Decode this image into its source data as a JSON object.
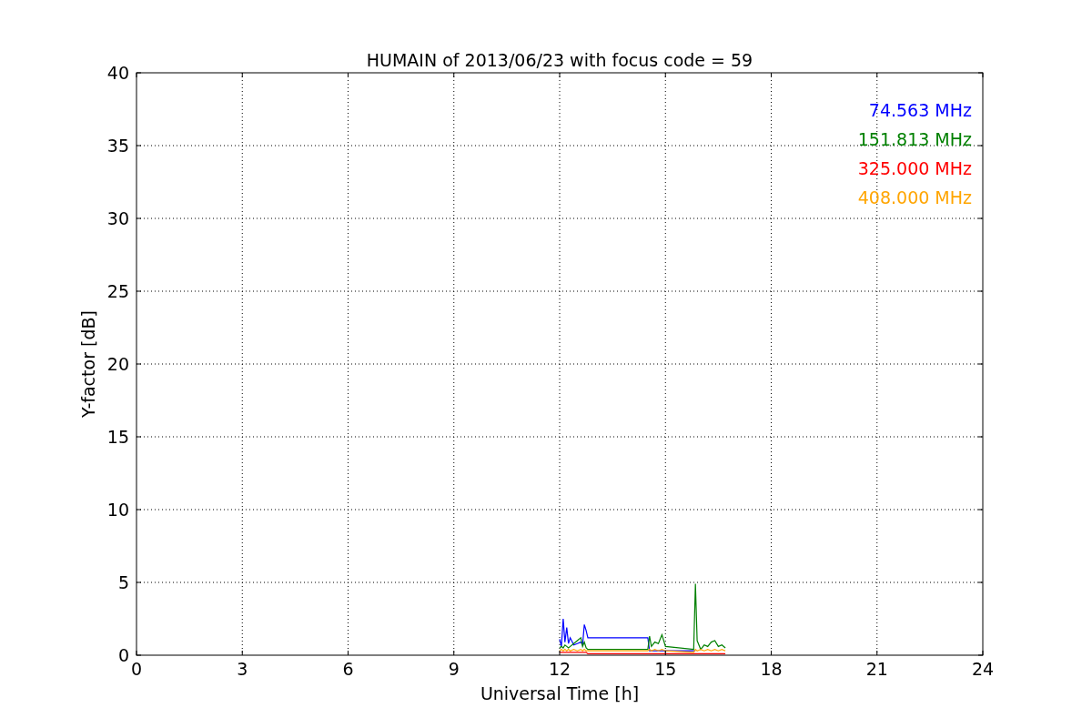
{
  "chart_data": {
    "type": "line",
    "title": "HUMAIN of 2013/06/23 with focus code = 59",
    "xlabel": "Universal Time [h]",
    "ylabel": "Y-factor [dB]",
    "x": [
      12.0,
      12.05,
      12.1,
      12.15,
      12.2,
      12.25,
      12.3,
      12.4,
      12.5,
      12.6,
      12.65,
      12.7,
      12.75,
      12.8,
      14.5,
      14.55,
      14.6,
      14.7,
      14.8,
      14.9,
      15.0,
      15.8,
      15.85,
      15.9,
      16.0,
      16.1,
      16.2,
      16.3,
      16.4,
      16.5,
      16.6,
      16.7
    ],
    "series": [
      {
        "name": "74.563 MHz",
        "color": "#0000ff",
        "values": [
          1.1,
          0.6,
          2.5,
          0.9,
          1.9,
          0.8,
          1.2,
          0.7,
          0.8,
          0.9,
          0.7,
          2.1,
          1.7,
          1.2,
          1.2,
          0.3,
          0.3,
          0.3,
          0.3,
          0.3,
          0.3,
          0.3,
          0.3,
          null,
          null,
          null,
          null,
          null,
          null,
          null,
          null,
          null
        ]
      },
      {
        "name": "151.813 MHz",
        "color": "#008000",
        "values": [
          0.5,
          0.6,
          0.5,
          0.7,
          0.6,
          0.5,
          0.6,
          0.8,
          1.0,
          1.2,
          0.6,
          0.9,
          0.5,
          0.4,
          0.4,
          1.3,
          0.6,
          0.9,
          0.8,
          1.4,
          0.6,
          0.4,
          4.9,
          1.0,
          0.4,
          0.7,
          0.6,
          0.9,
          1.0,
          0.6,
          0.7,
          0.5
        ]
      },
      {
        "name": "325.000 MHz",
        "color": "#ff0000",
        "values": [
          0.2,
          0.2,
          0.2,
          0.2,
          0.2,
          0.2,
          0.2,
          0.2,
          0.2,
          0.2,
          0.2,
          0.2,
          0.2,
          0.1,
          0.1,
          0.1,
          0.1,
          0.1,
          0.1,
          0.1,
          0.1,
          0.1,
          0.1,
          0.1,
          0.1,
          0.1,
          0.1,
          0.1,
          0.1,
          0.1,
          0.1,
          0.1
        ]
      },
      {
        "name": "408.000 MHz",
        "color": "#ffa500",
        "values": [
          0.3,
          0.4,
          0.3,
          0.4,
          0.3,
          0.4,
          0.3,
          0.4,
          0.3,
          0.4,
          0.3,
          0.4,
          0.3,
          0.3,
          0.3,
          0.4,
          0.3,
          0.4,
          0.3,
          0.4,
          0.3,
          0.2,
          0.4,
          0.3,
          0.4,
          0.3,
          0.4,
          0.3,
          0.4,
          0.3,
          0.4,
          0.3
        ]
      }
    ],
    "grid": true,
    "xlim": [
      0,
      24
    ],
    "ylim": [
      0,
      40
    ],
    "xticks": [
      0,
      3,
      6,
      9,
      12,
      15,
      18,
      21,
      24
    ],
    "yticks": [
      0,
      5,
      10,
      15,
      20,
      25,
      30,
      35,
      40
    ]
  }
}
